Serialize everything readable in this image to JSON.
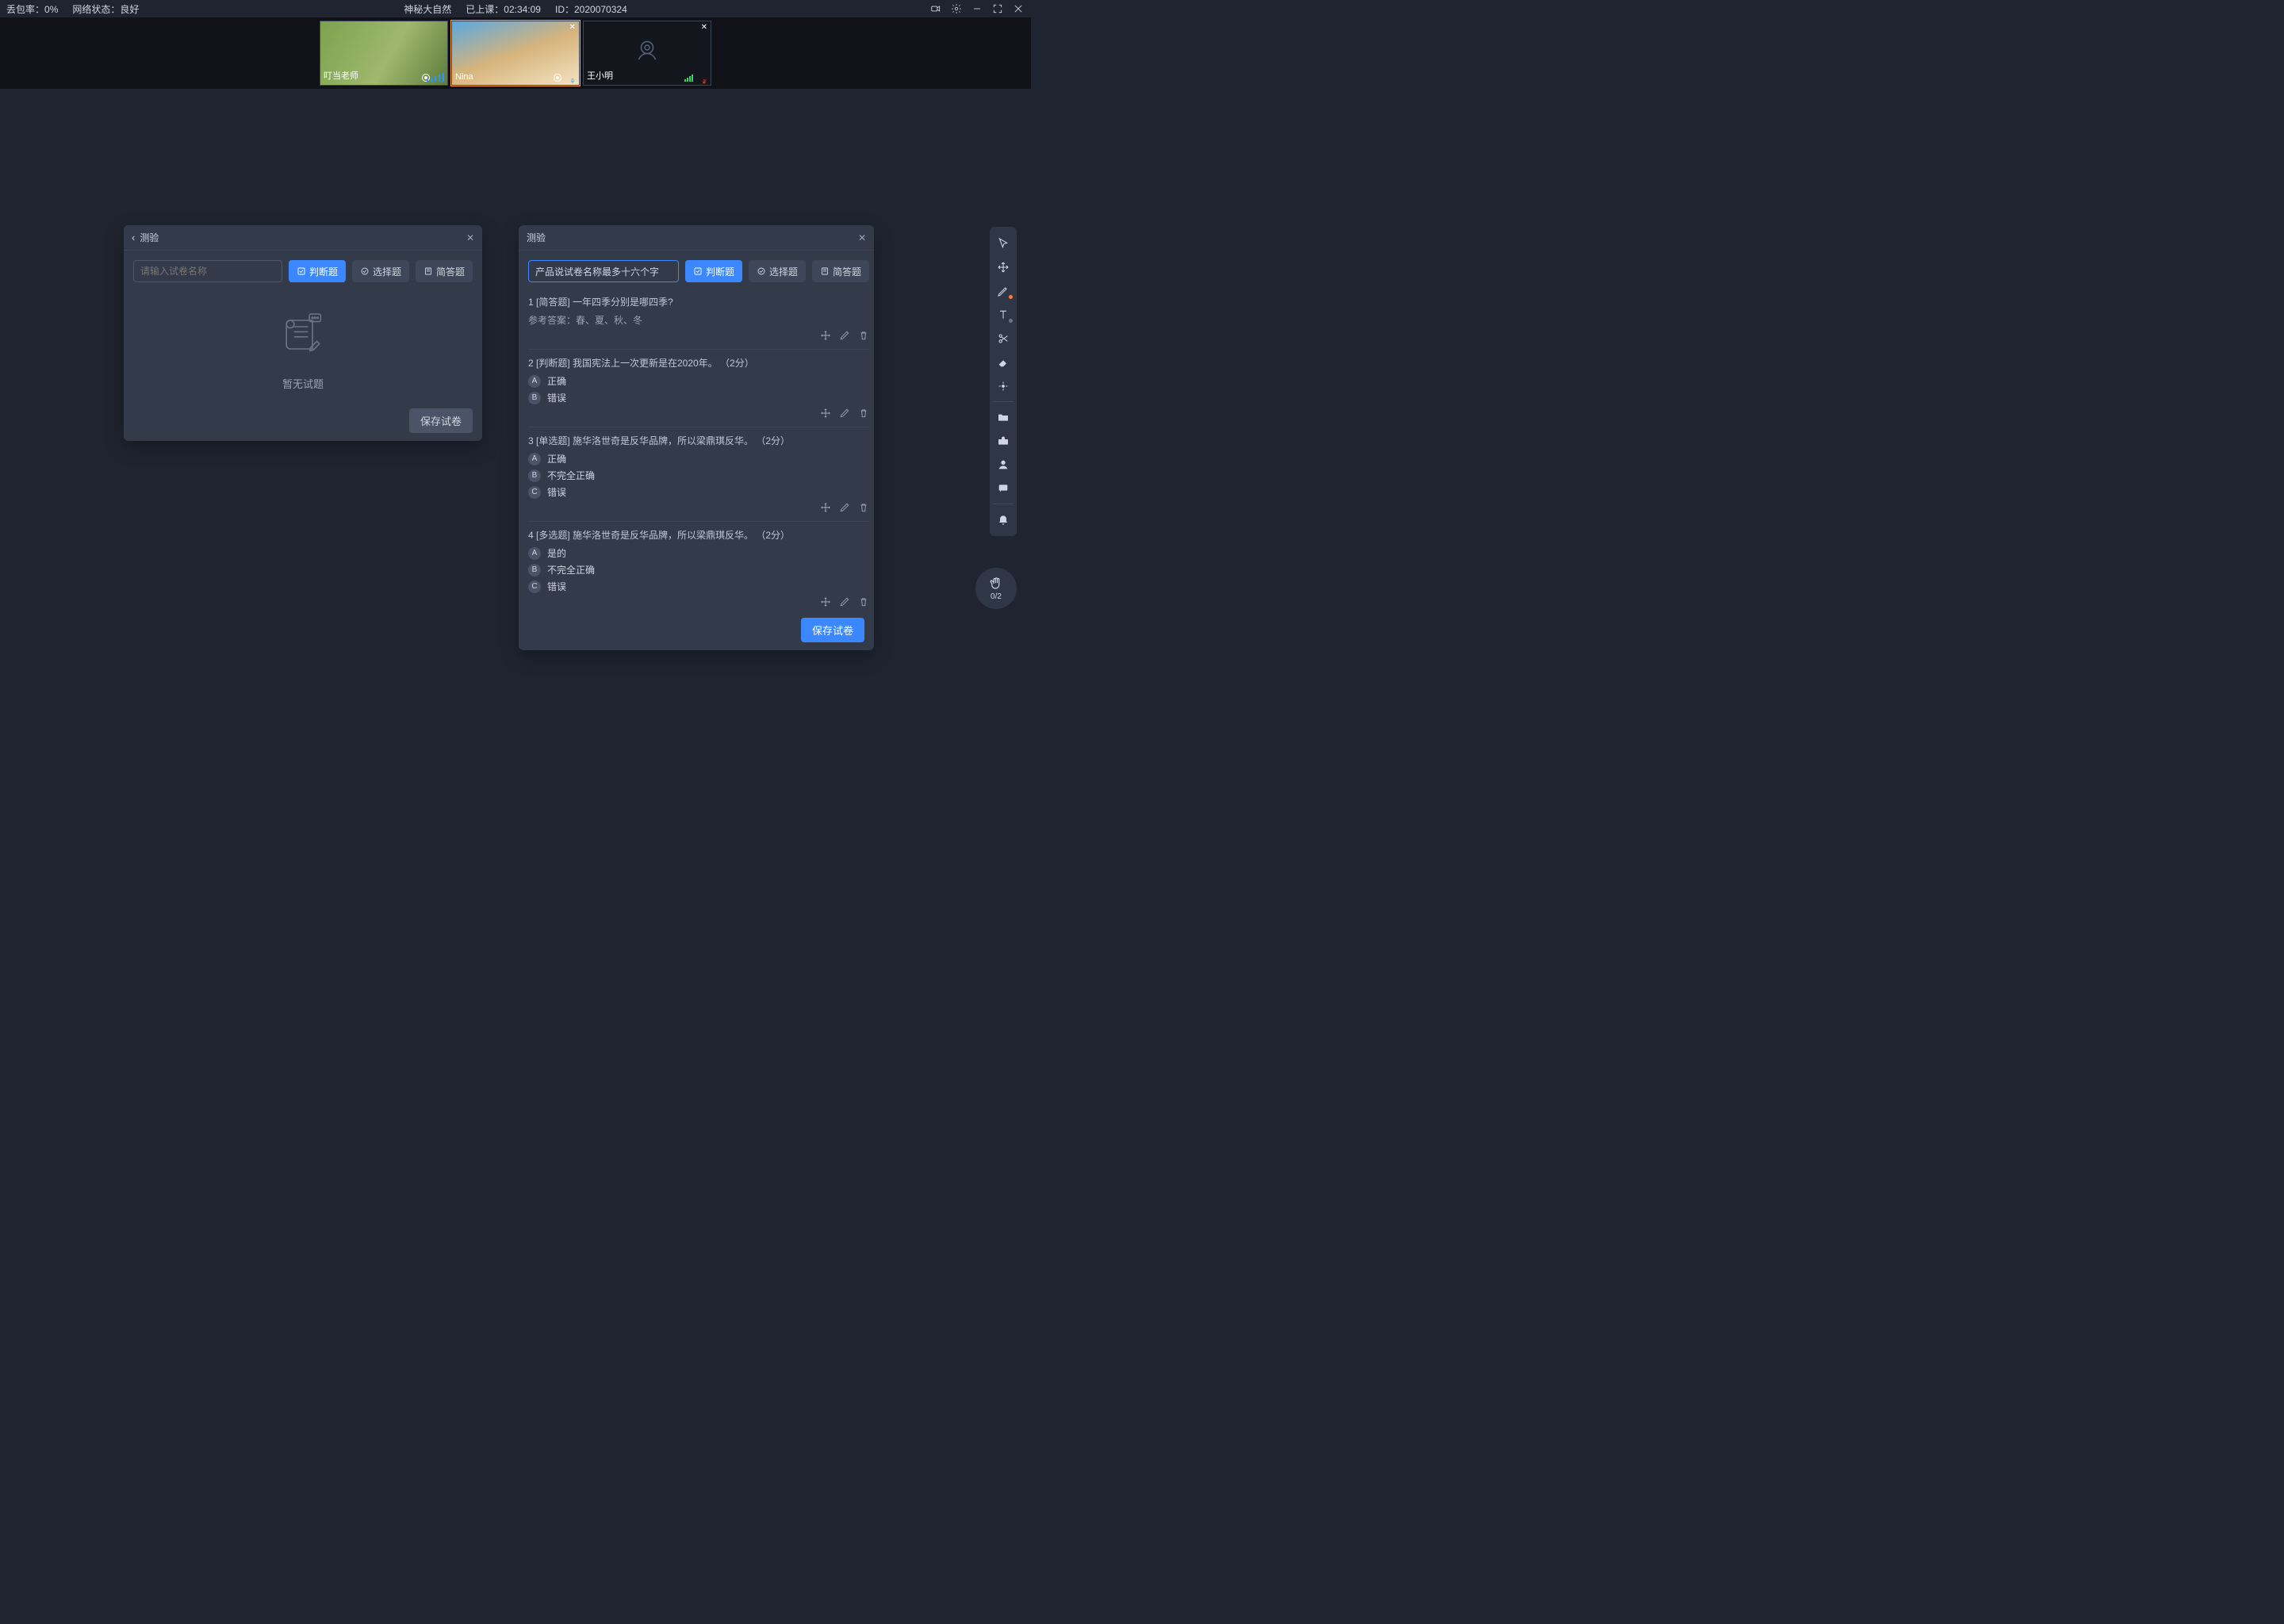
{
  "topbar": {
    "packet_loss_label": "丢包率：",
    "packet_loss_value": "0%",
    "net_label": "网络状态：",
    "net_value": "良好",
    "title": "神秘大自然",
    "class_label": "已上课：",
    "class_time": "02:34:09",
    "id_label": "ID：",
    "id_value": "2020070324"
  },
  "videos": [
    {
      "name": "叮当老师",
      "closable": false,
      "mic": "on",
      "cam": "on"
    },
    {
      "name": "Nina",
      "closable": true,
      "mic": "on",
      "cam": "on"
    },
    {
      "name": "王小明",
      "closable": true,
      "mic": "muted",
      "cam": "off"
    }
  ],
  "panel_a": {
    "title": "测验",
    "input_placeholder": "请输入试卷名称",
    "type_buttons": [
      "判断题",
      "选择题",
      "简答题"
    ],
    "empty_text": "暂无试题",
    "save_label": "保存试卷"
  },
  "panel_b": {
    "title": "测验",
    "input_value": "产品说试卷名称最多十六个字",
    "type_buttons": [
      "判断题",
      "选择题",
      "简答题"
    ],
    "save_label": "保存试卷",
    "answer_prefix": "参考答案：",
    "questions": [
      {
        "num": "1",
        "type": "[简答题]",
        "text": "一年四季分别是哪四季?",
        "answer": "春、夏、秋、冬",
        "options": []
      },
      {
        "num": "2",
        "type": "[判断题]",
        "text": "我国宪法上一次更新是在2020年。",
        "score": "（2分）",
        "options": [
          {
            "k": "A",
            "v": "正确"
          },
          {
            "k": "B",
            "v": "错误"
          }
        ]
      },
      {
        "num": "3",
        "type": "[单选题]",
        "text": "施华洛世奇是反华品牌，所以梁鼎琪反华。",
        "score": "（2分）",
        "options": [
          {
            "k": "A",
            "v": "正确"
          },
          {
            "k": "B",
            "v": "不完全正确"
          },
          {
            "k": "C",
            "v": "错误"
          }
        ]
      },
      {
        "num": "4",
        "type": "[多选题]",
        "text": "施华洛世奇是反华品牌，所以梁鼎琪反华。",
        "score": "（2分）",
        "options": [
          {
            "k": "A",
            "v": "是的"
          },
          {
            "k": "B",
            "v": "不完全正确"
          },
          {
            "k": "C",
            "v": "错误"
          }
        ]
      }
    ]
  },
  "hand_badge": {
    "count": "0/2"
  },
  "toolbar_items": [
    "pointer",
    "move",
    "pen",
    "text",
    "scissors",
    "eraser",
    "laser",
    "sep",
    "folder",
    "toolbox",
    "user",
    "chat",
    "sep",
    "bell"
  ]
}
